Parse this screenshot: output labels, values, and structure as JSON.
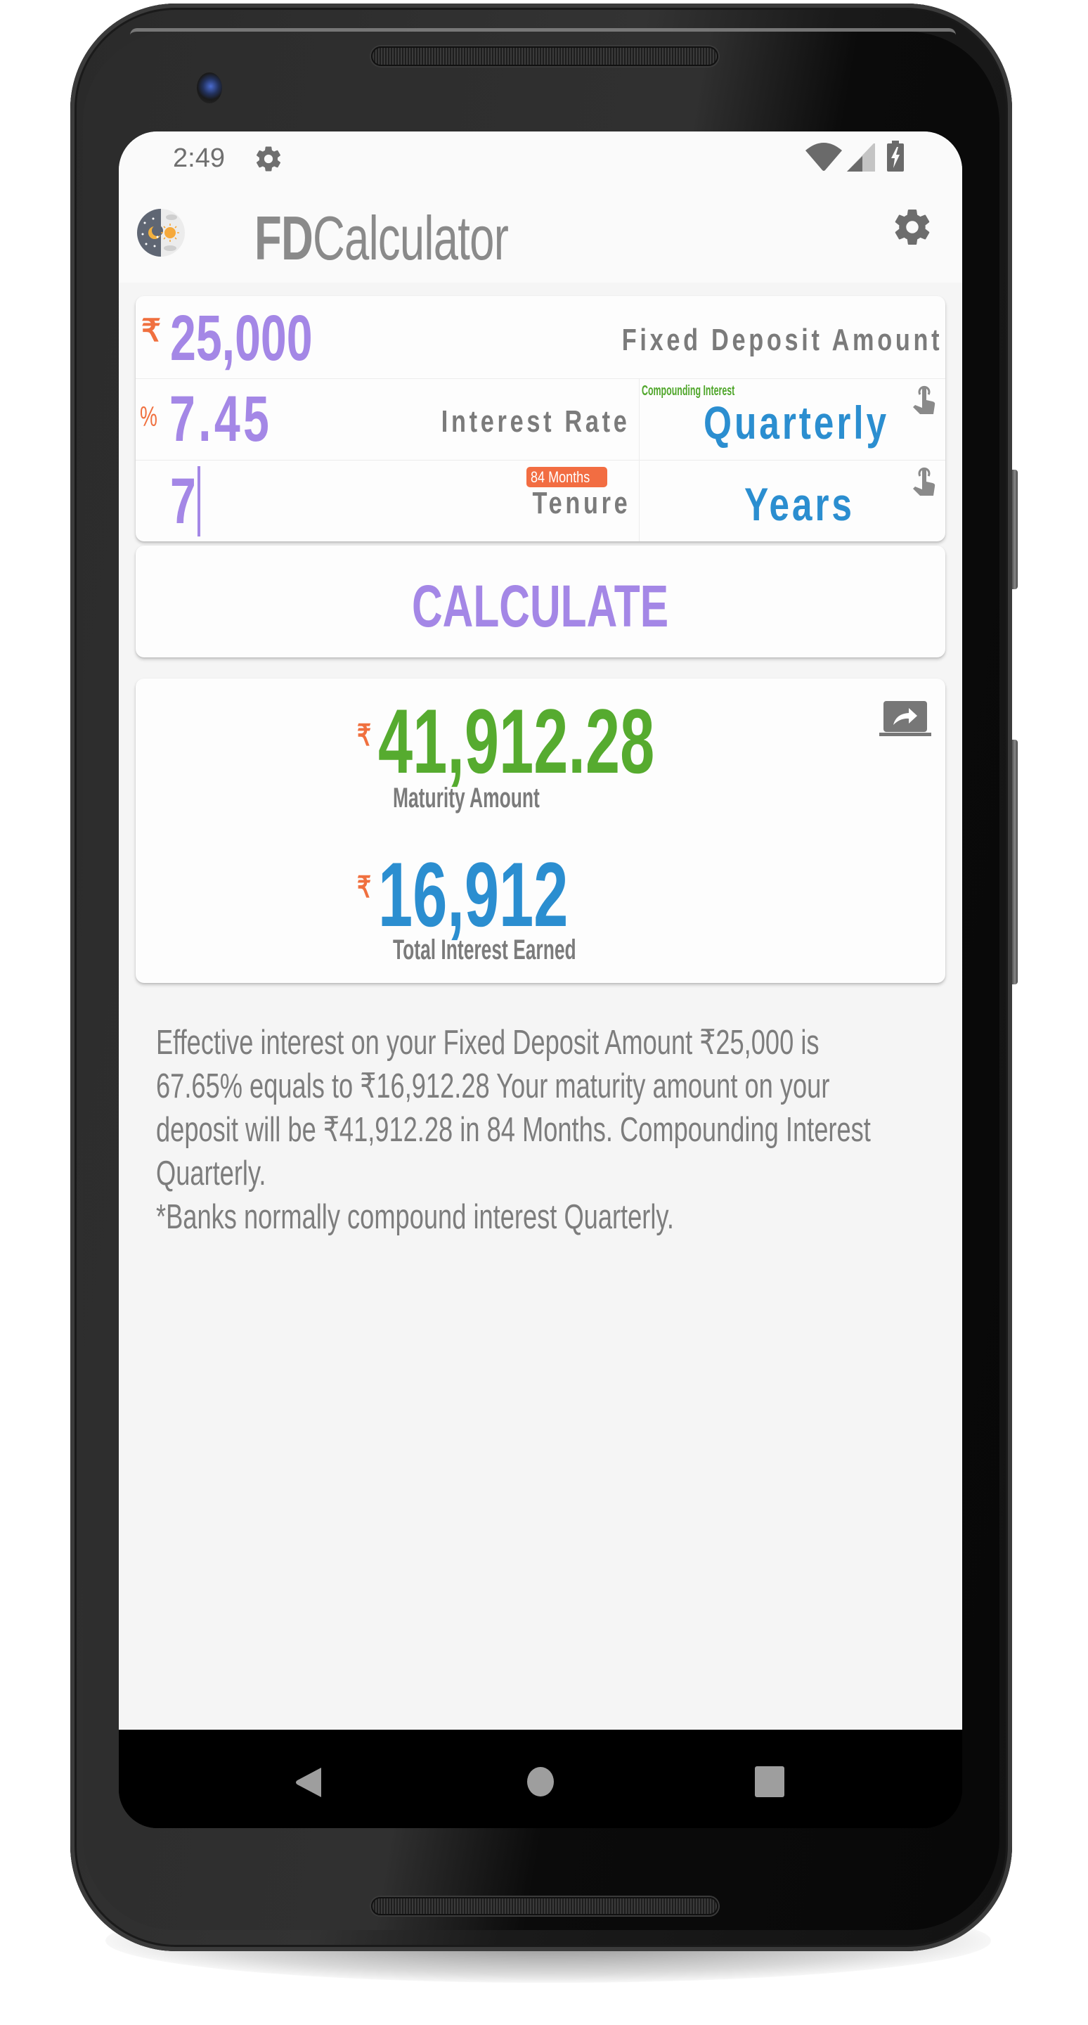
{
  "device": {
    "status_bar": {
      "time": "2:49",
      "icons": [
        "settings-gear-icon",
        "wifi-icon",
        "cellular-signal-icon",
        "battery-charging-icon"
      ]
    },
    "nav_bar": {
      "buttons": [
        "back",
        "home",
        "recents"
      ]
    }
  },
  "app_bar": {
    "icon": "day-night-icon",
    "title_bold": "FD",
    "title_rest": "Calculator",
    "settings_icon": "gear-icon"
  },
  "inputs": {
    "amount": {
      "prefix": "₹",
      "value": "25,000",
      "label": "Fixed Deposit Amount"
    },
    "rate": {
      "prefix": "%",
      "value": "7.45",
      "label": "Interest Rate"
    },
    "compounding": {
      "caption": "Compounding Interest",
      "value": "Quarterly",
      "icon": "tap-icon"
    },
    "tenure": {
      "value": "7",
      "label": "Tenure",
      "badge": "84 Months"
    },
    "tenure_unit": {
      "value": "Years",
      "icon": "tap-icon"
    }
  },
  "calculate_button": {
    "label": "CALCULATE"
  },
  "results": {
    "maturity": {
      "prefix": "₹",
      "value": "41,912.28",
      "label": "Maturity Amount"
    },
    "interest": {
      "prefix": "₹",
      "value": "16,912",
      "label": "Total Interest Earned"
    },
    "share_icon": "share-screen-icon"
  },
  "description": {
    "lines": [
      "Effective interest on your Fixed Deposit Amount ₹25,000 is",
      "67.65% equals to ₹16,912.28 Your maturity amount on your",
      "deposit will be ₹41,912.28 in 84 Months. Compounding Interest",
      "Quarterly.",
      "*Banks normally compound interest Quarterly."
    ]
  },
  "colors": {
    "input_value": "#a487e6",
    "prefix": "#f0703f",
    "label": "#7b7b7b",
    "picker": "#2b8ed0",
    "maturity": "#56ab2f",
    "interest": "#2b8ed0",
    "badge": "#f26d42",
    "compounding_caption": "#4fa62a",
    "background": "#f5f5f5"
  }
}
